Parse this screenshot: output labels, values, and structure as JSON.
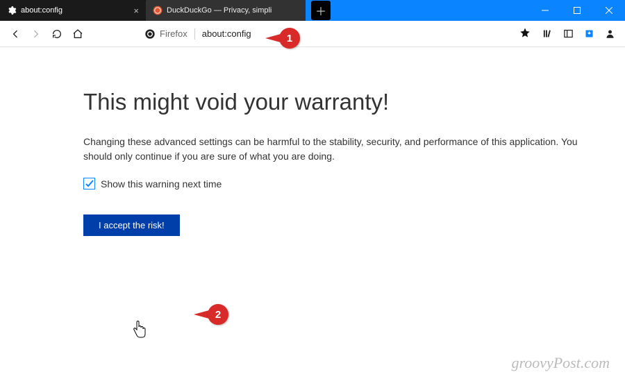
{
  "tabs": [
    {
      "label": "about:config"
    },
    {
      "label": "DuckDuckGo — Privacy, simpli"
    }
  ],
  "urlbar": {
    "identity": "Firefox",
    "url": "about:config"
  },
  "warning": {
    "title": "This might void your warranty!",
    "body": "Changing these advanced settings can be harmful to the stability, security, and performance of this application. You should only continue if you are sure of what you are doing.",
    "checkbox_label": "Show this warning next time",
    "accept_label": "I accept the risk!"
  },
  "callouts": {
    "c1": "1",
    "c2": "2"
  },
  "watermark": "groovyPost.com"
}
